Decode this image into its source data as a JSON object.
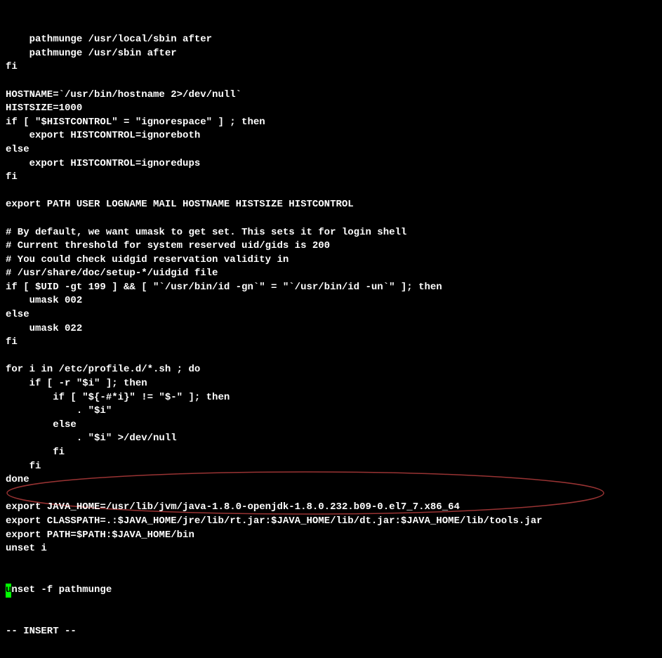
{
  "lines": [
    "    pathmunge /usr/local/sbin after",
    "    pathmunge /usr/sbin after",
    "fi",
    "",
    "HOSTNAME=`/usr/bin/hostname 2>/dev/null`",
    "HISTSIZE=1000",
    "if [ \"$HISTCONTROL\" = \"ignorespace\" ] ; then",
    "    export HISTCONTROL=ignoreboth",
    "else",
    "    export HISTCONTROL=ignoredups",
    "fi",
    "",
    "export PATH USER LOGNAME MAIL HOSTNAME HISTSIZE HISTCONTROL",
    "",
    "# By default, we want umask to get set. This sets it for login shell",
    "# Current threshold for system reserved uid/gids is 200",
    "# You could check uidgid reservation validity in",
    "# /usr/share/doc/setup-*/uidgid file",
    "if [ $UID -gt 199 ] && [ \"`/usr/bin/id -gn`\" = \"`/usr/bin/id -un`\" ]; then",
    "    umask 002",
    "else",
    "    umask 022",
    "fi",
    "",
    "for i in /etc/profile.d/*.sh ; do",
    "    if [ -r \"$i\" ]; then",
    "        if [ \"${-#*i}\" != \"$-\" ]; then",
    "            . \"$i\"",
    "        else",
    "            . \"$i\" >/dev/null",
    "        fi",
    "    fi",
    "done",
    "",
    "export JAVA_HOME=/usr/lib/jvm/java-1.8.0-openjdk-1.8.0.232.b09-0.el7_7.x86_64",
    "export CLASSPATH=.:$JAVA_HOME/jre/lib/rt.jar:$JAVA_HOME/lib/dt.jar:$JAVA_HOME/lib/tools.jar",
    "export PATH=$PATH:$JAVA_HOME/bin",
    "unset i"
  ],
  "cursor_line_prefix": "",
  "cursor_char": "u",
  "cursor_line_suffix": "nset -f pathmunge",
  "status_line": "-- INSERT --",
  "annotation_color": "#aa3333"
}
